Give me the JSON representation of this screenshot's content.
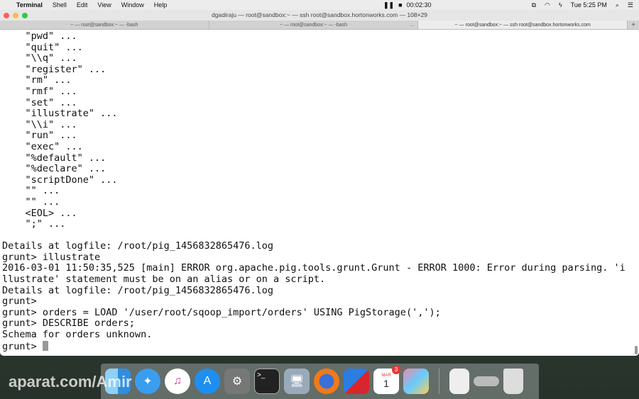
{
  "menubar": {
    "app": "Terminal",
    "items": [
      "Shell",
      "Edit",
      "View",
      "Window",
      "Help"
    ],
    "recorder_time": "00:02:30",
    "clock": "Tue 5:25 PM"
  },
  "window": {
    "title": "dgadiraju — root@sandbox:~ — ssh root@sandbox.hortonworks.com — 108×29",
    "tabs": [
      "~ — root@sandbox:~ — -bash",
      "~ — root@sandbox:~ — -bash",
      "~ — root@sandbox:~ — ssh root@sandbox.hortonworks.com"
    ],
    "tab_more": "...",
    "tab_add": "+"
  },
  "terminal": {
    "lines": [
      "    \"pwd\" ...",
      "    \"quit\" ...",
      "    \"\\\\q\" ...",
      "    \"register\" ...",
      "    \"rm\" ...",
      "    \"rmf\" ...",
      "    \"set\" ...",
      "    \"illustrate\" ...",
      "    \"\\\\i\" ...",
      "    \"run\" ...",
      "    \"exec\" ...",
      "    \"%default\" ...",
      "    \"%declare\" ...",
      "    \"scriptDone\" ...",
      "    \"\" ...",
      "    \"\" ...",
      "    <EOL> ...",
      "    \";\" ...",
      "",
      "Details at logfile: /root/pig_1456832865476.log",
      "grunt> illustrate",
      "2016-03-01 11:50:35,525 [main] ERROR org.apache.pig.tools.grunt.Grunt - ERROR 1000: Error during parsing. 'i",
      "llustrate' statement must be on an alias or on a script.",
      "Details at logfile: /root/pig_1456832865476.log",
      "grunt>",
      "grunt> orders = LOAD '/user/root/sqoop_import/orders' USING PigStorage(',');",
      "grunt> DESCRIBE orders;",
      "Schema for orders unknown."
    ],
    "prompt": "grunt> "
  },
  "dock": {
    "calendar_month": "MAR",
    "calendar_day": "1",
    "calendar_badge": "3",
    "apps": [
      "finder",
      "safari",
      "itunes",
      "app-store",
      "system-preferences",
      "terminal",
      "remote-desktop",
      "firefox",
      "parallels",
      "calendar",
      "photo-booth",
      "archive",
      "display",
      "trash"
    ]
  },
  "watermark": "aparat.com/Amir"
}
